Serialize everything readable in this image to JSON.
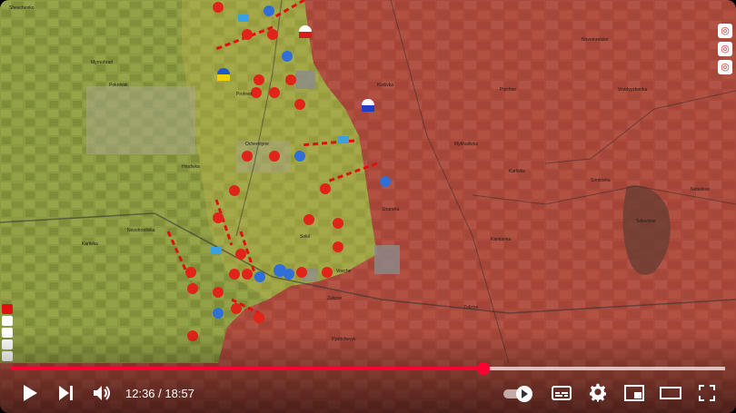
{
  "player": {
    "time_current": "12:36",
    "time_total": "18:57",
    "time_separator": " / ",
    "progress": 0.661,
    "buffered": 1.0
  },
  "colors": {
    "accent": "#ff0033",
    "ru_zone": "#b05040",
    "ua_zone": "#8a9a40"
  },
  "icons": [
    "play-icon",
    "next-icon",
    "volume-icon",
    "autoplay-toggle",
    "subtitles-icon",
    "settings-icon",
    "miniplayer-icon",
    "theater-icon",
    "fullscreen-icon"
  ],
  "map": {
    "labels": [
      "Pokrovsk",
      "Myrnohrad",
      "Kotlyne",
      "Novohrodivka",
      "Selydove",
      "Hrodivka",
      "Krasnyi Yar",
      "Mykhailivka",
      "Zhelanne",
      "Ocheretyne",
      "Sokil",
      "Vovche",
      "Prohres",
      "Skuchne",
      "Karlivka",
      "Yevhenivka",
      "Sontsivka",
      "Novopavlivka",
      "Vozdvyzhenka",
      "Ptychne",
      "Zalizne",
      "Novotoretske",
      "Tonenke",
      "Netailove"
    ]
  }
}
